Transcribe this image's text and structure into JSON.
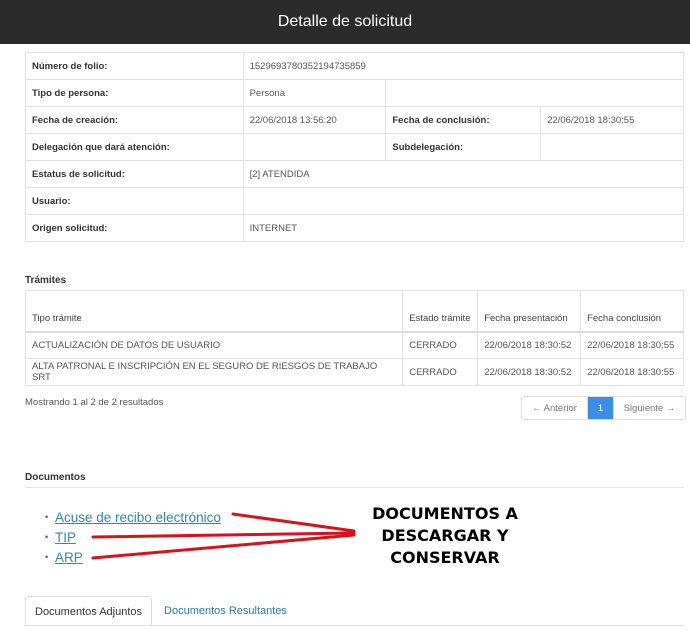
{
  "header": {
    "title": "Detalle de solicitud"
  },
  "detail": {
    "folio_label": "Número de folio:",
    "folio_value": "1529693780352194735859",
    "tipo_label": "Tipo de persona:",
    "tipo_value": "Persona",
    "creacion_label": "Fecha de creación:",
    "creacion_value": "22/06/2018 13:56:20",
    "conclusion_label": "Fecha de conclusión:",
    "conclusion_value": "22/06/2018 18:30:55",
    "delegacion_label": "Delegación que dará atención:",
    "delegacion_value": "",
    "subdelegacion_label": "Subdelegación:",
    "subdelegacion_value": "",
    "estatus_label": "Estatus de solicitud:",
    "estatus_value": "[2] ATENDIDA",
    "usuario_label": "Usuario:",
    "usuario_value": "",
    "origen_label": "Origen solicitud:",
    "origen_value": "INTERNET"
  },
  "tramites": {
    "title": "Trámites",
    "headers": [
      "Tipo trámite",
      "Estado trámite",
      "Fecha presentación",
      "Fecha conclusión"
    ],
    "rows": [
      [
        "ACTUALIZACIÓN DE DATOS DE USUARIO",
        "CERRADO",
        "22/06/2018 18:30:52",
        "22/06/2018 18:30:55"
      ],
      [
        "ALTA PATRONAL E INSCRIPCIÓN EN EL SEGURO DE RIESGOS DE TRABAJO SRT",
        "CERRADO",
        "22/06/2018 18:30:52",
        "22/06/2018 18:30:55"
      ]
    ],
    "showing": "Mostrando 1 al 2 de 2 resultados",
    "pager": {
      "prev": "← Anterior",
      "current": "1",
      "next": "Siguiente →"
    }
  },
  "documentos": {
    "title": "Documentos",
    "bullet": "•",
    "links": [
      "Acuse de recibo electrónico",
      "TIP",
      "ARP"
    ]
  },
  "annotation": {
    "lines": [
      "DOCUMENTOS A",
      "DESCARGAR Y",
      "CONSERVAR"
    ]
  },
  "colors": {
    "header_bg": "#2b2b2b",
    "link": "#2a8ab8",
    "page_active": "#3a8ee6",
    "annotation_arrow": "#d4141c"
  },
  "tabs": {
    "adjuntos": "Documentos Adjuntos",
    "resultantes": "Documentos Resultantes"
  }
}
